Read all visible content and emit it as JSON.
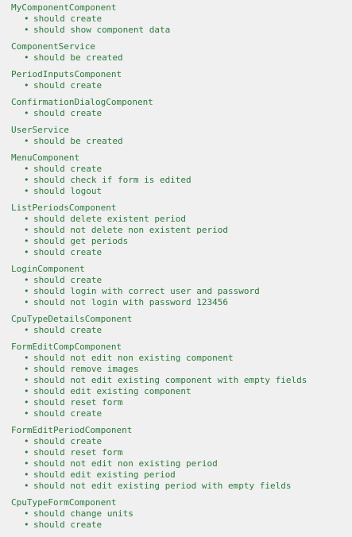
{
  "colors": {
    "background": "#f0f0f0",
    "text": "#2a7a3c"
  },
  "bullet_glyph": "•",
  "suites": [
    {
      "name": "MyComponentComponent",
      "specs": [
        "should create",
        "should show component data"
      ]
    },
    {
      "name": "ComponentService",
      "specs": [
        "should be created"
      ]
    },
    {
      "name": "PeriodInputsComponent",
      "specs": [
        "should create"
      ]
    },
    {
      "name": "ConfirmationDialogComponent",
      "specs": [
        "should create"
      ]
    },
    {
      "name": "UserService",
      "specs": [
        "should be created"
      ]
    },
    {
      "name": "MenuComponent",
      "specs": [
        "should create",
        "should check if form is edited",
        "should logout"
      ]
    },
    {
      "name": "ListPeriodsComponent",
      "specs": [
        "should delete existent period",
        "should not delete non existent period",
        "should get periods",
        "should create"
      ]
    },
    {
      "name": "LoginComponent",
      "specs": [
        "should create",
        "should login with correct user and password",
        "should not login with password 123456"
      ]
    },
    {
      "name": "CpuTypeDetailsComponent",
      "specs": [
        "should create"
      ]
    },
    {
      "name": "FormEditCompComponent",
      "specs": [
        "should not edit non existing component",
        "should remove images",
        "should not edit existing component with empty fields",
        "should edit existing component",
        "should reset form",
        "should create"
      ]
    },
    {
      "name": "FormEditPeriodComponent",
      "specs": [
        "should create",
        "should reset form",
        "should not edit non existing period",
        "should edit existing period",
        "should not edit existing period with empty fields"
      ]
    },
    {
      "name": "CpuTypeFormComponent",
      "specs": [
        "should change units",
        "should create"
      ]
    }
  ]
}
